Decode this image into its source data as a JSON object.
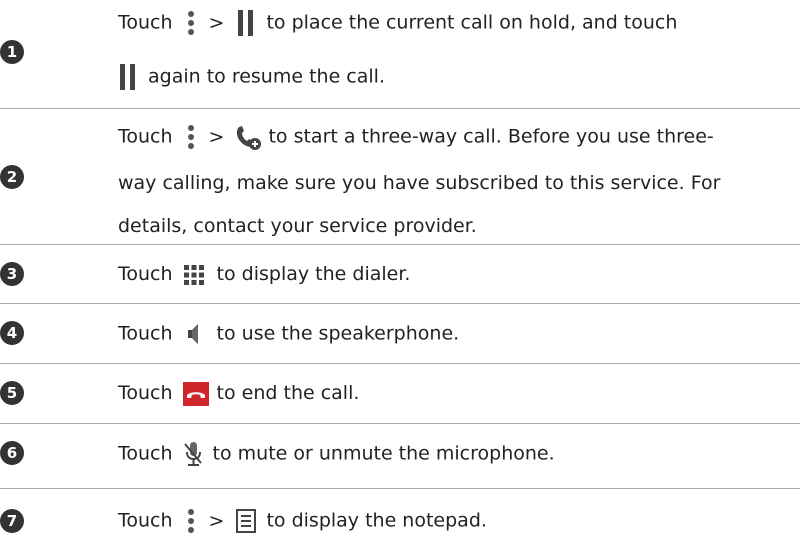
{
  "rows": [
    {
      "number": "1",
      "parts": {
        "touch": "Touch",
        "gt": ">",
        "l1_rest": "to place the current call on hold, and touch",
        "l2_rest": "again to resume the call."
      },
      "icons": [
        "more-options-icon",
        "hold-icon",
        "hold-icon"
      ]
    },
    {
      "number": "2",
      "parts": {
        "touch": "Touch",
        "gt": ">",
        "l1_rest": "to start a three-way call. Before you use three-",
        "l2": "way calling, make sure you have subscribed to this service. For",
        "l3": "details, contact your service provider."
      },
      "icons": [
        "more-options-icon",
        "add-call-icon"
      ]
    },
    {
      "number": "3",
      "parts": {
        "touch": "Touch",
        "rest": "to display the dialer."
      },
      "icons": [
        "dialer-icon"
      ]
    },
    {
      "number": "4",
      "parts": {
        "touch": "Touch",
        "rest": "to use the speakerphone."
      },
      "icons": [
        "speaker-icon"
      ]
    },
    {
      "number": "5",
      "parts": {
        "touch": "Touch",
        "rest": "to end the call."
      },
      "icons": [
        "end-call-icon"
      ]
    },
    {
      "number": "6",
      "parts": {
        "touch": "Touch",
        "rest": "to mute or unmute the microphone."
      },
      "icons": [
        "mute-microphone-icon"
      ]
    },
    {
      "number": "7",
      "parts": {
        "touch": "Touch",
        "gt": ">",
        "rest": "to display the notepad."
      },
      "icons": [
        "more-options-icon",
        "notepad-icon"
      ]
    }
  ],
  "colors": {
    "badge": "#333333",
    "text": "#222222",
    "rule": "#aaaaaa",
    "end_call_red": "#d0262b"
  }
}
